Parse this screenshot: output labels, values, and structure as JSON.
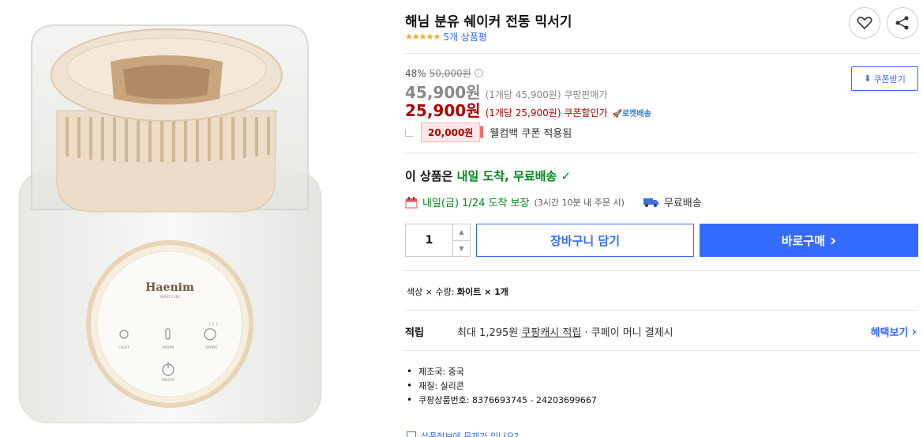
{
  "product": {
    "title": "해님 분유 쉐이커 전동 믹서기",
    "stars": "★★★★★",
    "review_count": "5개 상품평",
    "rating": 5,
    "brand_mark": "Haenim",
    "brand_sub": "SMART CARE",
    "control_labels": [
      "LIGHT",
      "WARM",
      "SWING",
      "ON/OFF"
    ],
    "swing_speeds": "1  2  3"
  },
  "pricing": {
    "discount_rate": "48%",
    "original_price": "50,000원",
    "sale_price": "45,900원",
    "sale_unit": "(1개당 45,900원) 쿠팡판매가",
    "coupon_price": "25,900원",
    "coupon_unit": "(1개당 25,900원) 쿠폰할인가",
    "rocket_label": "로켓배송",
    "coupon_button": "쿠폰받기",
    "welcome_amount": "20,000원",
    "welcome_text": "웰컴백 쿠폰 적용됨"
  },
  "delivery": {
    "headline_prefix": "이 상품은 ",
    "headline_highlight": "내일 도착, 무료배송",
    "check": "✓",
    "date_text": "내일(금) 1/24 도착 보장",
    "date_note": "(3시간 10분 내 주문 시)",
    "free_shipping": "무료배송"
  },
  "purchase": {
    "quantity": "1",
    "cart_label": "장바구니 담기",
    "buy_label": "바로구매",
    "buy_chevron": "›"
  },
  "option": {
    "label": "색상 × 수량: ",
    "value": "화이트 × 1개"
  },
  "points": {
    "label": "적립",
    "text_before": "최대 1,295원 ",
    "link": "쿠팡캐시 적립",
    "text_after": " · 쿠페이 머니 결제시",
    "benefit_link": "혜택보기",
    "benefit_chevron": "›"
  },
  "specs": [
    "제조국: 중국",
    "재질: 실리콘",
    "쿠팡상품번호: 8376693745 - 24203699667"
  ],
  "report": {
    "text": "상품정보에 문제가 있나요?"
  },
  "colors": {
    "accent_blue": "#346aff",
    "price_red": "#ae0000",
    "delivery_green": "#00891a",
    "star_yellow": "#f5a623"
  }
}
